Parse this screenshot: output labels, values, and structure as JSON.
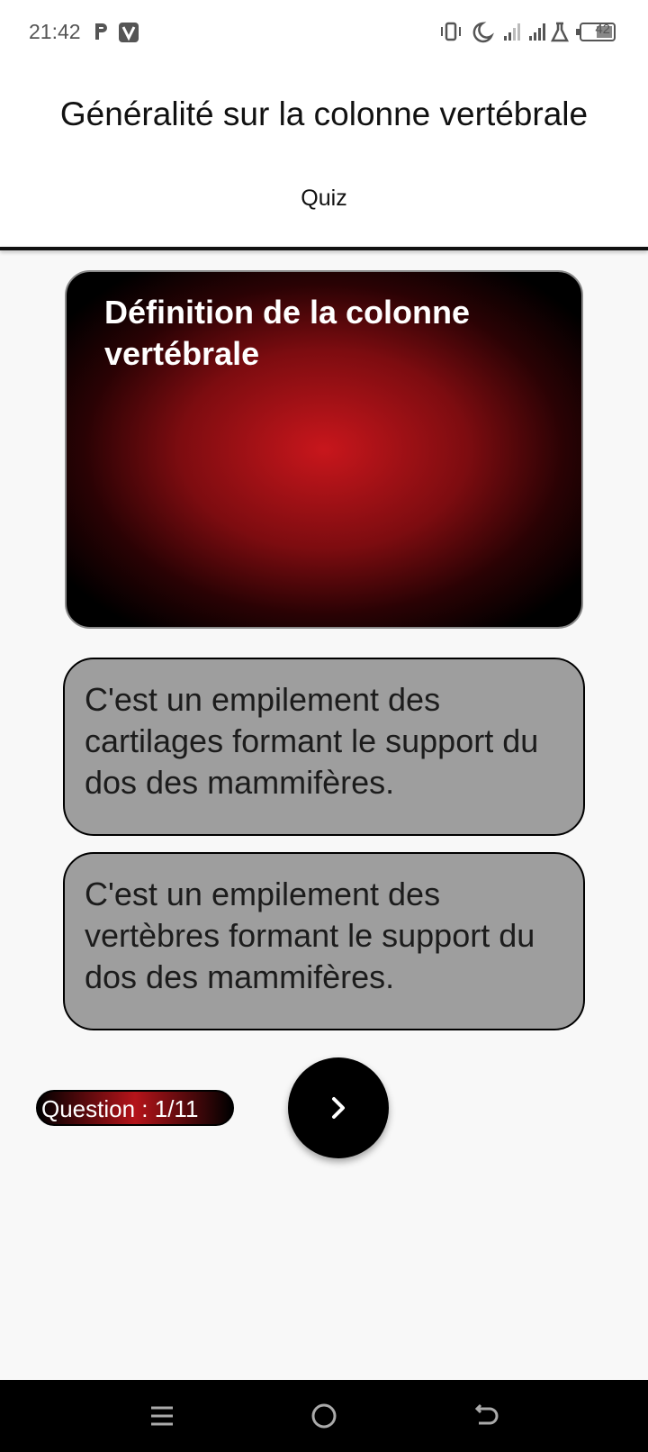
{
  "status_bar": {
    "time": "21:42",
    "battery_level": "42",
    "icons": [
      "p-icon",
      "v-app-icon",
      "vibrate-icon",
      "moon-icon",
      "signal-icon",
      "signal-icon",
      "flask-icon",
      "battery-icon"
    ]
  },
  "header": {
    "title": "Généralité sur la colonne vertébrale",
    "tab_label": "Quiz"
  },
  "question": {
    "text": "Définition de la colonne vertébrale"
  },
  "answers": [
    {
      "text": "C'est un empilement des cartilages formant le support du dos des mammifères."
    },
    {
      "text": "C'est un empilement des vertèbres formant le support du dos des mammifères."
    }
  ],
  "footer": {
    "counter": "Question : 1/11",
    "next_icon": "chevron-right-icon"
  },
  "nav": {
    "icons": [
      "menu-icon",
      "home-icon",
      "back-icon"
    ]
  },
  "colors": {
    "accent_red": "#c8161c",
    "answer_bg": "#9e9e9e",
    "dark": "#000000"
  }
}
